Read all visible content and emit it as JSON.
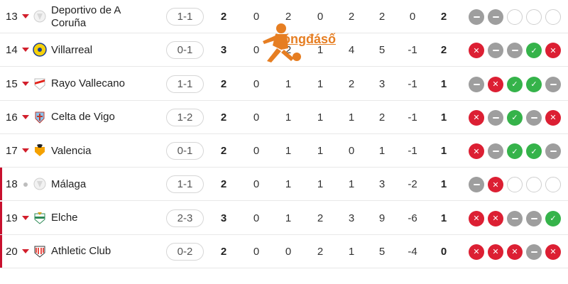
{
  "watermark": {
    "text": "bóngđásố"
  },
  "colors": {
    "loss": "#dc1f33",
    "draw": "#9e9e9e",
    "win": "#35b34a",
    "relegation": "#c8102e",
    "accent": "#e67e22"
  },
  "rows": [
    {
      "rank": "13",
      "trend": "down",
      "crest_icon": "deportivo-crest-icon",
      "team": "Deportivo de A Coruña",
      "score": "1-1",
      "stats": [
        "2",
        "0",
        "2",
        "0",
        "2",
        "2",
        "0",
        "2"
      ],
      "form": [
        "D",
        "D",
        "E",
        "E",
        "E"
      ],
      "relegation": false
    },
    {
      "rank": "14",
      "trend": "down",
      "crest_icon": "villarreal-crest-icon",
      "team": "Villarreal",
      "score": "0-1",
      "stats": [
        "3",
        "0",
        "2",
        "1",
        "4",
        "5",
        "-1",
        "2"
      ],
      "form": [
        "L",
        "D",
        "D",
        "W",
        "L"
      ],
      "relegation": false
    },
    {
      "rank": "15",
      "trend": "down",
      "crest_icon": "rayo-vallecano-crest-icon",
      "team": "Rayo Vallecano",
      "score": "1-1",
      "stats": [
        "2",
        "0",
        "1",
        "1",
        "2",
        "3",
        "-1",
        "1"
      ],
      "form": [
        "D",
        "L",
        "W",
        "W",
        "D"
      ],
      "relegation": false
    },
    {
      "rank": "16",
      "trend": "down",
      "crest_icon": "celta-vigo-crest-icon",
      "team": "Celta de Vigo",
      "score": "1-2",
      "stats": [
        "2",
        "0",
        "1",
        "1",
        "1",
        "2",
        "-1",
        "1"
      ],
      "form": [
        "L",
        "D",
        "W",
        "D",
        "L"
      ],
      "relegation": false
    },
    {
      "rank": "17",
      "trend": "down",
      "crest_icon": "valencia-crest-icon",
      "team": "Valencia",
      "score": "0-1",
      "stats": [
        "2",
        "0",
        "1",
        "1",
        "0",
        "1",
        "-1",
        "1"
      ],
      "form": [
        "L",
        "D",
        "W",
        "W",
        "D"
      ],
      "relegation": false
    },
    {
      "rank": "18",
      "trend": "neutral",
      "crest_icon": "malaga-crest-icon",
      "team": "Málaga",
      "score": "1-1",
      "stats": [
        "2",
        "0",
        "1",
        "1",
        "1",
        "3",
        "-2",
        "1"
      ],
      "form": [
        "D",
        "L",
        "E",
        "E",
        "E"
      ],
      "relegation": true
    },
    {
      "rank": "19",
      "trend": "down",
      "crest_icon": "elche-crest-icon",
      "team": "Elche",
      "score": "2-3",
      "stats": [
        "3",
        "0",
        "1",
        "2",
        "3",
        "9",
        "-6",
        "1"
      ],
      "form": [
        "L",
        "L",
        "D",
        "D",
        "W"
      ],
      "relegation": true
    },
    {
      "rank": "20",
      "trend": "down",
      "crest_icon": "athletic-club-crest-icon",
      "team": "Athletic Club",
      "score": "0-2",
      "stats": [
        "2",
        "0",
        "0",
        "2",
        "1",
        "5",
        "-4",
        "0"
      ],
      "form": [
        "L",
        "L",
        "L",
        "D",
        "L"
      ],
      "relegation": true
    }
  ]
}
